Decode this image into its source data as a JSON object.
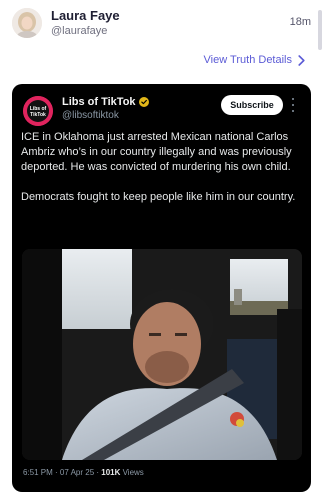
{
  "truth": {
    "display_name": "Laura Faye",
    "handle": "@laurafaye",
    "timestamp": "18m",
    "details_link": "View Truth Details"
  },
  "embedded_post": {
    "account_name": "Libs of TikTok",
    "account_handle": "@libsoftiktok",
    "avatar_text_top": "Libs of",
    "avatar_text_bottom": "TikTok",
    "subscribe_label": "Subscribe",
    "paragraph_1": "ICE in Oklahoma just arrested Mexican national Carlos Ambriz who’s in our country illegally and was previously deported. He was convicted of murdering his own child.",
    "paragraph_2": "Democrats fought to keep people like him in our country.",
    "posted_at": "6:51 PM · 07 Apr 25 · ",
    "view_count": "101K",
    "views_label": " Views",
    "icons": {
      "verified": "verified-badge-icon",
      "more": "more-options-icon",
      "chevron": "chevron-right-icon"
    }
  },
  "colors": {
    "link": "#5b5bd6",
    "card_background": "#000000",
    "verified_gold": "#e2b719",
    "avatar_pink": "#e0245e"
  }
}
